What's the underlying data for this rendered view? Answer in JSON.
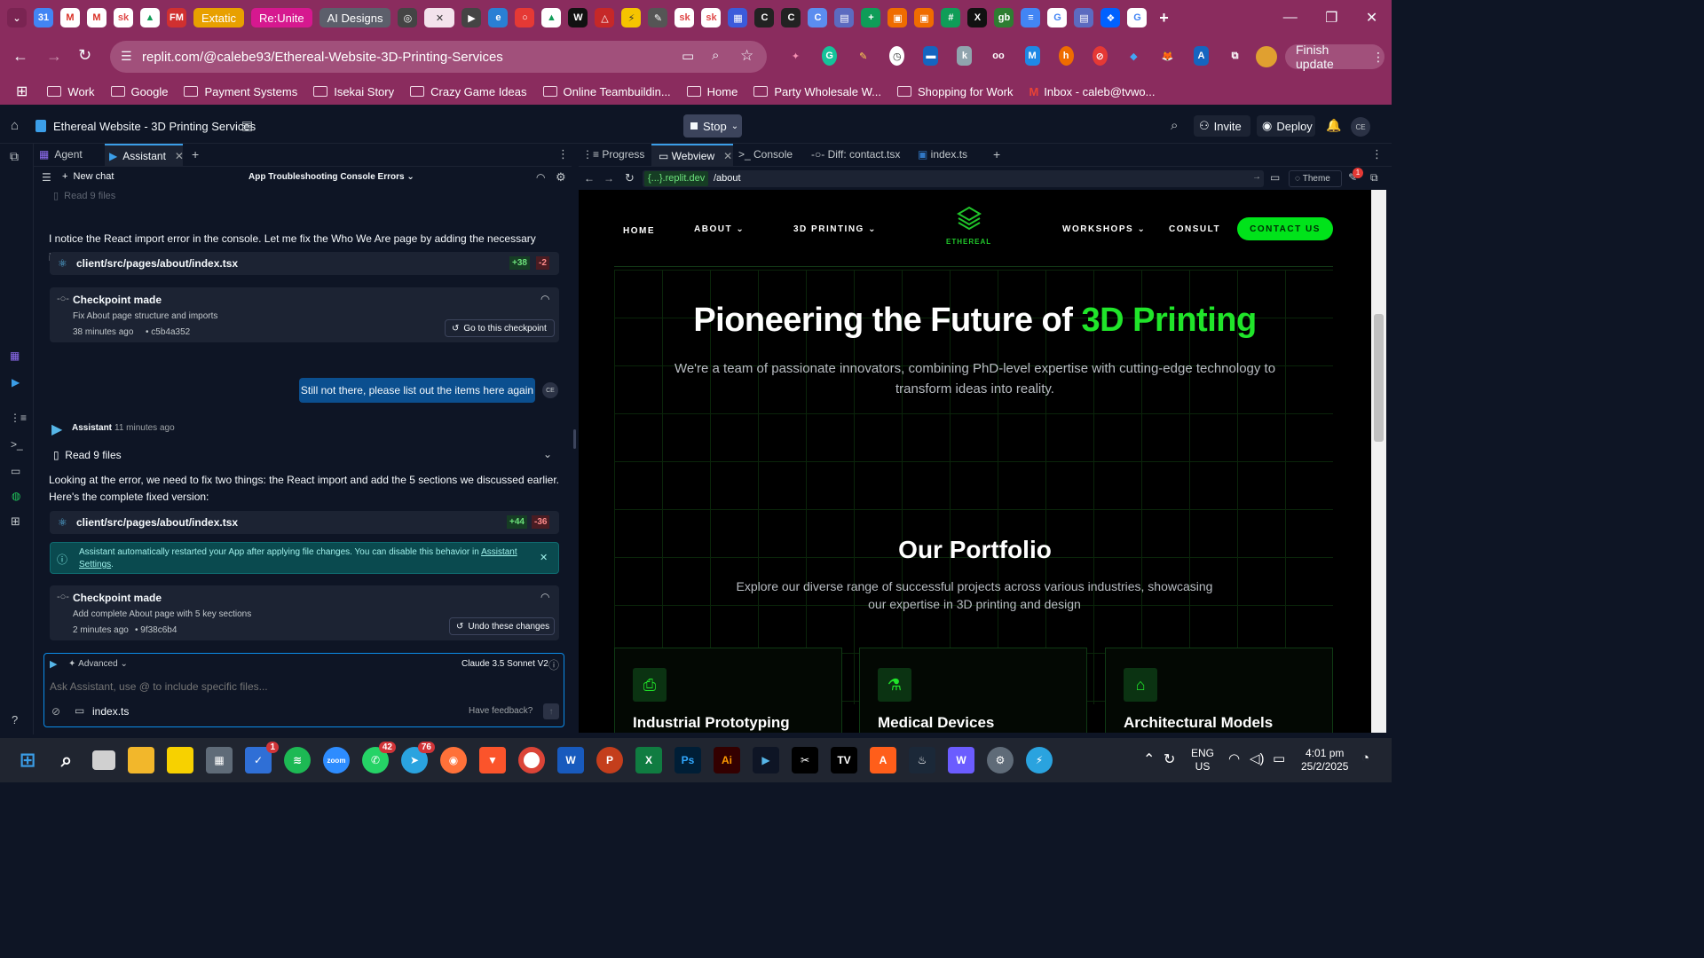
{
  "browser": {
    "tabs_pills": [
      "Extatic",
      "Re:Unite",
      "AI Designs"
    ],
    "url": "replit.com/@calebe93/Ethereal-Website-3D-Printing-Services",
    "finish_update": "Finish update",
    "bookmarks": [
      "Work",
      "Google",
      "Payment Systems",
      "Isekai Story",
      "Crazy Game Ideas",
      "Online Teambuildin...",
      "Home",
      "Party Wholesale W...",
      "Shopping for Work",
      "Inbox - caleb@tvwo..."
    ]
  },
  "replit": {
    "project_title": "Ethereal Website - 3D Printing Services",
    "stop": "Stop",
    "invite": "Invite",
    "deploy": "Deploy",
    "avatar": "CE"
  },
  "chat": {
    "tabs": [
      "Agent",
      "Assistant"
    ],
    "new_chat": "New chat",
    "chat_title": "App Troubleshooting Console Errors",
    "read_files_top": "Read 9 files",
    "msg1": "I notice the React import error in the console. Let me fix the Who We Are page by adding the necessary import and making sure the Portfolio component is properly imported:",
    "file1": {
      "name": "client/src/pages/about/index.tsx",
      "add": "+38",
      "del": "-2"
    },
    "cp1": {
      "title": "Checkpoint made",
      "desc": "Fix About page structure and imports",
      "time": "38 minutes ago",
      "hash": "• c5b4a352",
      "button": "Go to this checkpoint"
    },
    "user_msg": "Still not there, please list out the items here again",
    "user_avatar": "CE",
    "assistant_name": "Assistant",
    "assistant_time": "11 minutes ago",
    "read_files": "Read 9 files",
    "msg2": "Looking at the error, we need to fix two things: the React import and add the 5 sections we discussed earlier. Here's the complete fixed version:",
    "file2": {
      "name": "client/src/pages/about/index.tsx",
      "add": "+44",
      "del": "-36"
    },
    "notice": "Assistant automatically restarted your App after applying file changes. You can disable this behavior in",
    "notice_link": "Assistant Settings",
    "cp2": {
      "title": "Checkpoint made",
      "desc": "Add complete About page with 5 key sections",
      "time": "2 minutes ago",
      "hash": "• 9f38c6b4",
      "button": "Undo these changes"
    },
    "advanced": "Advanced",
    "model": "Claude 3.5 Sonnet V2",
    "input_placeholder": "Ask Assistant, use @ to include specific files...",
    "attached_file": "index.ts",
    "feedback": "Have feedback?"
  },
  "webview": {
    "tabs": [
      "Progress",
      "Webview",
      "Console",
      "Diff: contact.tsx",
      "index.ts"
    ],
    "domain": "{...}.replit.dev",
    "path": "/about",
    "theme": "Theme",
    "notif_count": "1"
  },
  "site": {
    "nav": [
      "HOME",
      "ABOUT",
      "3D PRINTING",
      "WORKSHOPS",
      "CONSULT"
    ],
    "contact": "CONTACT US",
    "logo": "ETHEREAL",
    "hero_title_a": "Pioneering the Future of ",
    "hero_title_b": "3D Printing",
    "hero_sub": "We're a team of passionate innovators, combining PhD-level expertise with cutting-edge technology to transform ideas into reality.",
    "portfolio_title": "Our Portfolio",
    "portfolio_sub": "Explore our diverse range of successful projects across various industries, showcasing our expertise in 3D printing and design",
    "cards": [
      "Industrial Prototyping",
      "Medical Devices",
      "Architectural Models"
    ]
  },
  "taskbar": {
    "badges": [
      "1",
      "42",
      "76"
    ],
    "lang": "ENG",
    "region": "US",
    "time": "4:01 pm",
    "date": "25/2/2025"
  },
  "colors": {
    "accent_green": "#20e52a",
    "replit_bg": "#0e1525",
    "browser_pink": "#8a2c5e",
    "link_blue": "#0b4f8f"
  }
}
